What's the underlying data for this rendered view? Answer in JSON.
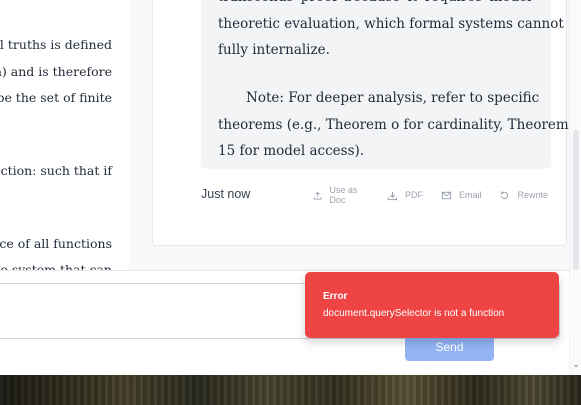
{
  "left_doc": {
    "lines": [
      "al truths is defined",
      "n) and is therefore",
      "be the set of finite",
      "ction: such that if",
      "ace of all functions",
      "le system that can"
    ]
  },
  "answer": {
    "para1_lines": [
      "transcends proof because it requires model-",
      "theoretic evaluation, which formal systems cannot",
      "fully internalize."
    ],
    "para2_lines": [
      "Note: For deeper analysis, refer to specific",
      "theorems (e.g., Theorem o for cardinality, Theorem",
      "15 for model access)."
    ]
  },
  "message": {
    "timestamp": "Just now",
    "actions": [
      {
        "label": "Use as Doc",
        "icon": "upload-icon"
      },
      {
        "label": "PDF",
        "icon": "download-icon"
      },
      {
        "label": "Email",
        "icon": "mail-icon"
      },
      {
        "label": "Rewrite",
        "icon": "rotate-icon"
      }
    ]
  },
  "composer": {
    "input_value": "",
    "send_label": "Send"
  },
  "error_toast": {
    "title": "Error",
    "message": "document.querySelector is not a function"
  },
  "colors": {
    "accent": "#93b4f5",
    "error": "#ef4444"
  }
}
